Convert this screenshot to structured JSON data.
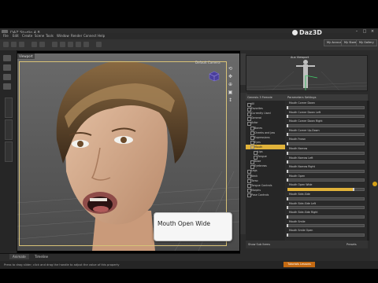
{
  "window": {
    "title": "DAZ Studio 4.8"
  },
  "menus": [
    "File",
    "Edit",
    "Create",
    "Scene",
    "Tools",
    "Window",
    "Render",
    "Connect",
    "Help"
  ],
  "brand": {
    "name": "Daz3D"
  },
  "header_buttons": [
    "My Account",
    "My Store",
    "My Gallery"
  ],
  "left_labels": {
    "scene_tab": "Character"
  },
  "viewport": {
    "tab_label": "Viewport",
    "camera_label": "Default Camera",
    "tooltip": "Mouth Open Wide"
  },
  "bottom_tabs": [
    "Animate",
    "Timeline"
  ],
  "status": {
    "text": "Press to drag slider; click and drag the handle to adjust the value of this property",
    "lessons": "Tutorials Lessons"
  },
  "aux_viewport": {
    "label": "Aux Viewport"
  },
  "param_pane": {
    "header_left": "Genesis 3 Female",
    "header_right": "Parameters Settings",
    "tree": [
      {
        "label": "All",
        "indent": 0
      },
      {
        "label": "Favorites",
        "indent": 0
      },
      {
        "label": "Currently Used",
        "indent": 0
      },
      {
        "label": "General",
        "indent": 0
      },
      {
        "label": "Actor",
        "indent": 0
      },
      {
        "label": "Bones",
        "indent": 1
      },
      {
        "label": "Cheeks and Jaw",
        "indent": 1
      },
      {
        "label": "Expressions",
        "indent": 1
      },
      {
        "label": "Eyes",
        "indent": 1
      },
      {
        "label": "Mouth",
        "indent": 1
      },
      {
        "label": "Lips",
        "indent": 2
      },
      {
        "label": "Tongue",
        "indent": 2
      },
      {
        "label": "Nose",
        "indent": 1
      },
      {
        "label": "Eyebrows",
        "indent": 1
      },
      {
        "label": "Legs",
        "indent": 0
      },
      {
        "label": "Neck",
        "indent": 0
      },
      {
        "label": "Torso",
        "indent": 0
      },
      {
        "label": "Tongue Controls",
        "indent": 0
      },
      {
        "label": "Morphs",
        "indent": 0
      },
      {
        "label": "Pose Controls",
        "indent": 0
      }
    ],
    "selected_item": "Mouth",
    "properties": [
      {
        "label": "Mouth Corner Down",
        "value": 0.0
      },
      {
        "label": "Mouth Corner Down Left",
        "value": 0.0
      },
      {
        "label": "Mouth Corner Down Right",
        "value": 0.0
      },
      {
        "label": "Mouth Corner Up-Down",
        "value": 0.0
      },
      {
        "label": "Mouth Frown",
        "value": 0.0
      },
      {
        "label": "Mouth Narrow",
        "value": 0.0
      },
      {
        "label": "Mouth Narrow Left",
        "value": 0.0
      },
      {
        "label": "Mouth Narrow Right",
        "value": 0.0
      },
      {
        "label": "Mouth Open",
        "value": 0.0
      },
      {
        "label": "Mouth Open Wide",
        "value": 0.86
      },
      {
        "label": "Mouth Side-Side",
        "value": 0.0
      },
      {
        "label": "Mouth Side-Side Left",
        "value": 0.0
      },
      {
        "label": "Mouth Side-Side Right",
        "value": 0.0
      },
      {
        "label": "Mouth Smile",
        "value": 0.0
      },
      {
        "label": "Mouth Smile Open",
        "value": 0.0
      }
    ],
    "footer_left": "Show Sub Items",
    "footer_right": "Presets"
  },
  "colors": {
    "accent": "#e0b23a",
    "frame": "#d8c277",
    "lessons": "#c46a12"
  }
}
